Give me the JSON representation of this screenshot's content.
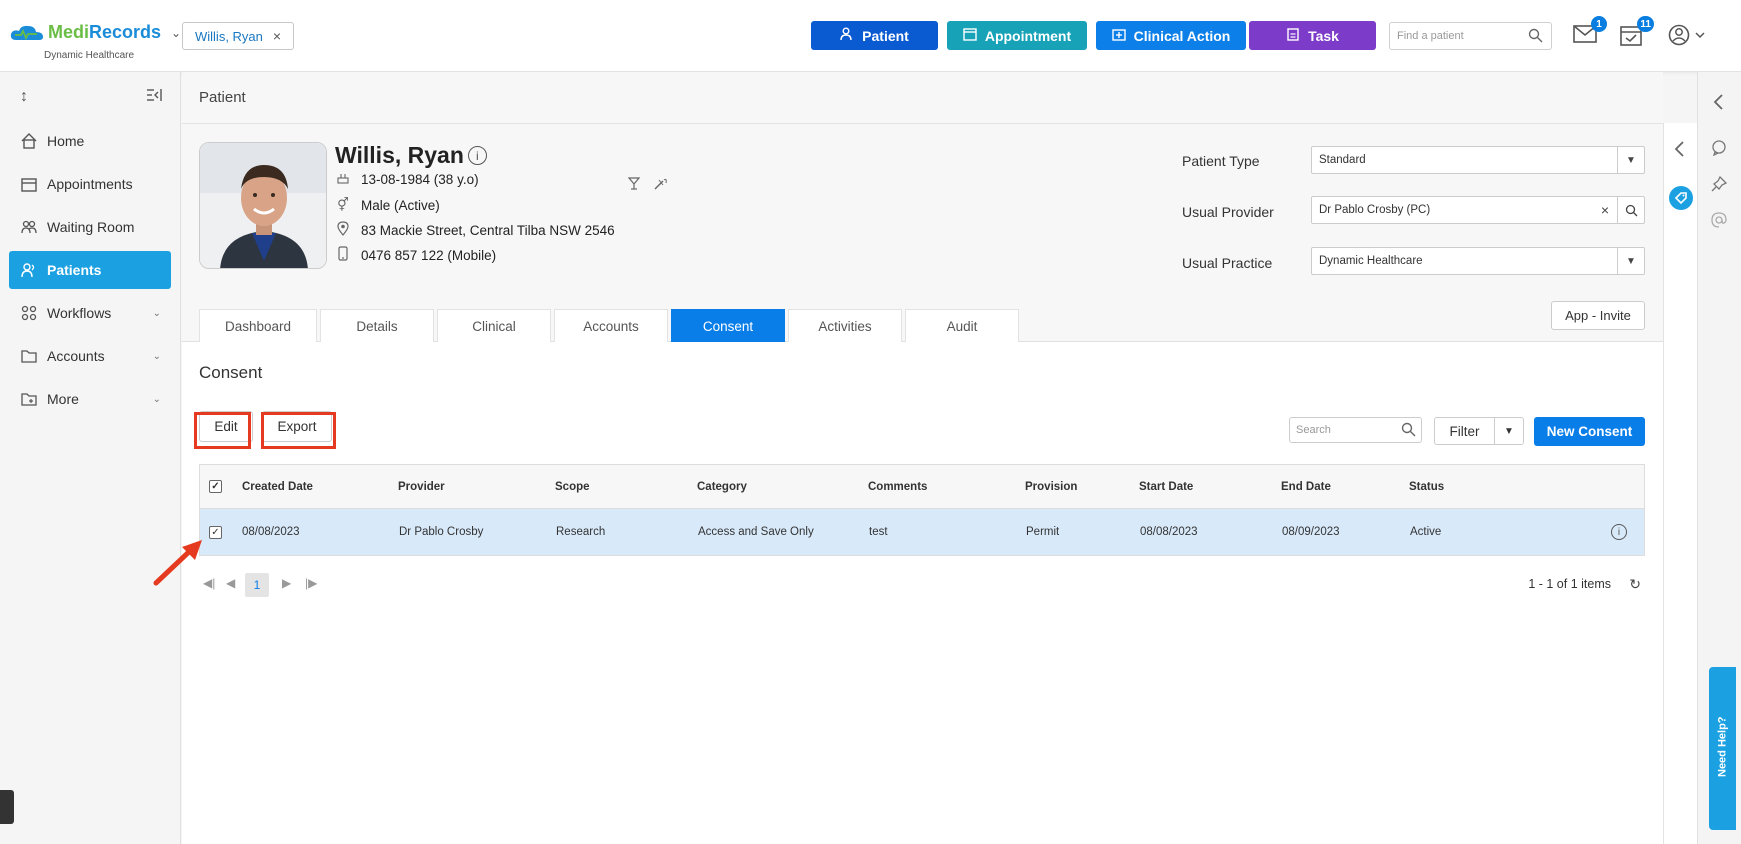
{
  "app": {
    "brand_a": "Medi",
    "brand_b": "Records",
    "practice": "Dynamic Healthcare"
  },
  "header": {
    "patient_chip": "Willis, Ryan",
    "buttons": {
      "patient": "Patient",
      "appointment": "Appointment",
      "clinical_action": "Clinical Action",
      "task": "Task"
    },
    "find_placeholder": "Find a patient",
    "mail_badge": "1",
    "tasks_badge": "11"
  },
  "sidebar": {
    "items": [
      {
        "label": "Home"
      },
      {
        "label": "Appointments"
      },
      {
        "label": "Waiting Room"
      },
      {
        "label": "Patients"
      },
      {
        "label": "Workflows"
      },
      {
        "label": "Accounts"
      },
      {
        "label": "More"
      }
    ]
  },
  "breadcrumb": "Patient",
  "patient": {
    "name": "Willis, Ryan",
    "dob": "13-08-1984 (38 y.o)",
    "gender": "Male (Active)",
    "address": "83 Mackie Street, Central Tilba NSW 2546",
    "phone": "0476 857 122 (Mobile)"
  },
  "fields": {
    "patient_type_label": "Patient Type",
    "patient_type_value": "Standard",
    "usual_provider_label": "Usual Provider",
    "usual_provider_value": "Dr Pablo Crosby (PC)",
    "usual_practice_label": "Usual Practice",
    "usual_practice_value": "Dynamic Healthcare",
    "app_invite": "App - Invite"
  },
  "tabs": [
    {
      "label": "Dashboard"
    },
    {
      "label": "Details"
    },
    {
      "label": "Clinical"
    },
    {
      "label": "Accounts"
    },
    {
      "label": "Consent"
    },
    {
      "label": "Activities"
    },
    {
      "label": "Audit"
    }
  ],
  "consent": {
    "title": "Consent",
    "edit": "Edit",
    "export": "Export",
    "search_placeholder": "Search",
    "filter": "Filter",
    "new_consent": "New Consent",
    "columns": [
      "Created Date",
      "Provider",
      "Scope",
      "Category",
      "Comments",
      "Provision",
      "Start Date",
      "End Date",
      "Status"
    ],
    "rows": [
      {
        "created": "08/08/2023",
        "provider": "Dr Pablo Crosby",
        "scope": "Research",
        "category": "Access and Save Only",
        "comments": "test",
        "provision": "Permit",
        "start": "08/08/2023",
        "end": "08/09/2023",
        "status": "Active"
      }
    ],
    "pager": {
      "page": "1",
      "count": "1 - 1 of 1 items"
    }
  },
  "help": {
    "label": "Need Help?"
  },
  "colors": {
    "primary": "#0a7ee8",
    "active_nav": "#1ba1e2",
    "highlight": "#e53a1f",
    "row_selected": "#d8e9fa"
  }
}
